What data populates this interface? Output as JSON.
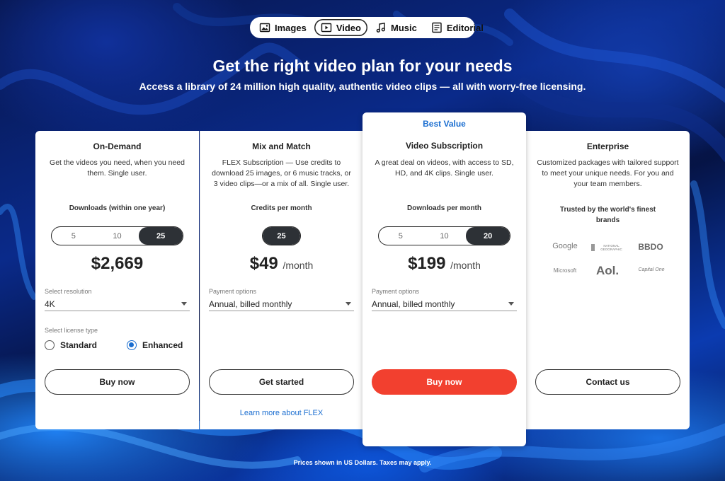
{
  "nav": {
    "items": [
      {
        "label": "Images",
        "icon": "image-icon"
      },
      {
        "label": "Video",
        "icon": "play-icon"
      },
      {
        "label": "Music",
        "icon": "music-note-icon"
      },
      {
        "label": "Editorial",
        "icon": "newspaper-icon"
      }
    ],
    "active": "Video"
  },
  "hero": {
    "title": "Get the right video plan for your needs",
    "subtitle": "Access a library of 24 million high quality, authentic video clips — all with worry-free licensing."
  },
  "plans": [
    {
      "title": "On-Demand",
      "description": "Get the videos you need, when you need them. Single user.",
      "quantity_label": "Downloads (within one year)",
      "options": [
        "5",
        "10",
        "25"
      ],
      "selected_option": "25",
      "price": "$2,669",
      "price_suffix": "",
      "select_label": "Select resolution",
      "select_value": "4K",
      "license_label": "Select license type",
      "license_options": [
        "Standard",
        "Enhanced"
      ],
      "license_selected": "Enhanced",
      "button": "Buy now"
    },
    {
      "title": "Mix and Match",
      "description": "FLEX Subscription — Use credits to download 25 images, or 6 music tracks, or 3 video clips—or a mix of all. Single user.",
      "quantity_label": "Credits per month",
      "options": [
        "25"
      ],
      "selected_option": "25",
      "price": "$49",
      "price_suffix": "/month",
      "select_label": "Payment options",
      "select_value": "Annual, billed monthly",
      "button": "Get started",
      "link": "Learn more about FLEX"
    },
    {
      "badge": "Best Value",
      "title": "Video Subscription",
      "description": "A great deal on videos, with access to SD, HD, and 4K clips. Single user.",
      "quantity_label": "Downloads per month",
      "options": [
        "5",
        "10",
        "20"
      ],
      "selected_option": "20",
      "price": "$199",
      "price_suffix": "/month",
      "select_label": "Payment options",
      "select_value": "Annual, billed monthly",
      "button": "Buy now"
    },
    {
      "title": "Enterprise",
      "description": "Customized packages with tailored support to meet your unique needs. For you and your team members.",
      "brands_label": "Trusted by the world's finest brands",
      "brands": [
        "Google",
        "NATIONAL GEOGRAPHIC",
        "BBDO",
        "Microsoft",
        "Aol.",
        "Capital One"
      ],
      "button": "Contact us"
    }
  ],
  "footnote": "Prices shown in US Dollars. Taxes may apply.",
  "colors": {
    "accent_blue": "#1b6ed0",
    "cta_red": "#f2402f",
    "segment_active": "#2d3136"
  }
}
